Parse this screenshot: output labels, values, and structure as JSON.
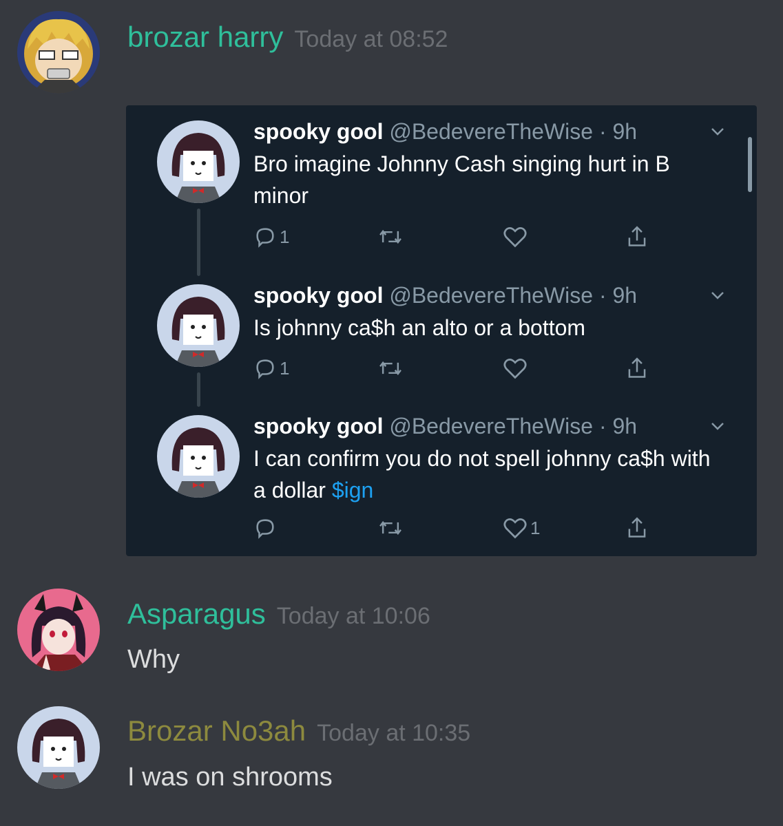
{
  "messages": [
    {
      "username": "brozar harry",
      "username_color": "#2fbf9b",
      "timestamp": "Today at 08:52"
    },
    {
      "username": "Asparagus",
      "username_color": "#2fbf9b",
      "timestamp": "Today at 10:06",
      "text": "Why"
    },
    {
      "username": "Brozar No3ah",
      "username_color": "#8d8a3e",
      "timestamp": "Today at 10:35",
      "text": "I was on shrooms"
    }
  ],
  "embed": {
    "tweets": [
      {
        "name": "spooky gool",
        "handle": "@BedevereTheWise",
        "time": "· 9h",
        "text": "Bro imagine Johnny Cash singing hurt in B minor",
        "reply_count": "1",
        "like_count": ""
      },
      {
        "name": "spooky gool",
        "handle": "@BedevereTheWise",
        "time": "· 9h",
        "text": "Is johnny ca$h an alto or a bottom",
        "reply_count": "1",
        "like_count": ""
      },
      {
        "name": "spooky gool",
        "handle": "@BedevereTheWise",
        "time": "· 9h",
        "text_before_link": "I can confirm you do not spell johnny ca$h with a dollar ",
        "link_text": "$ign",
        "reply_count": "",
        "like_count": "1"
      }
    ]
  },
  "icons": {
    "reply": "reply-icon",
    "retweet": "retweet-icon",
    "like": "heart-icon",
    "share": "share-icon",
    "more": "chevron-down-icon"
  },
  "colors": {
    "background": "#36393f",
    "embed_background": "#15202b",
    "link": "#1da1f2"
  }
}
